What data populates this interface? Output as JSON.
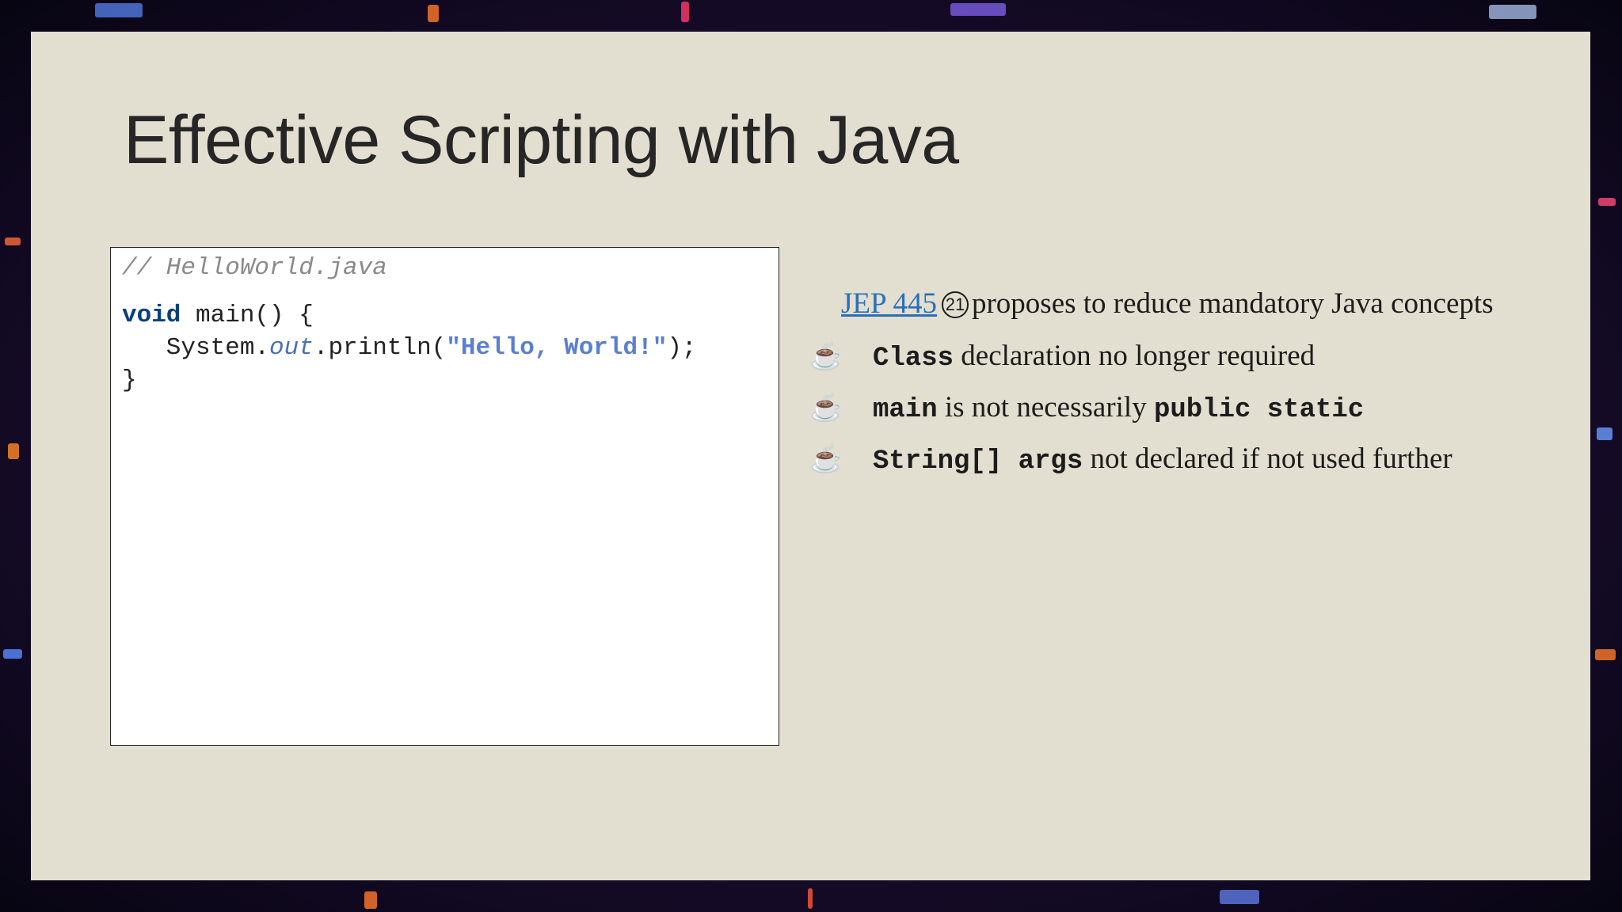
{
  "slide": {
    "title": "Effective Scripting with Java"
  },
  "code": {
    "comment": "// HelloWorld.java",
    "line1_kw": "void",
    "line1_rest": " main() {",
    "line2_prefix": "   System.",
    "line2_field": "out",
    "line2_mid": ".println(",
    "line2_string": "\"Hello, World!\"",
    "line2_end": ");",
    "line3": "}"
  },
  "notes": {
    "link_text": "JEP 445",
    "version_badge": "21",
    "intro_text": "proposes to reduce mandatory Java concepts",
    "bullet_icon": "coffee-cup-icon",
    "bullet_glyph": "☕",
    "bullets": [
      {
        "code1": "Class",
        "text1": " declaration no longer required",
        "code2": "",
        "text2": ""
      },
      {
        "code1": "main",
        "text1": " is not necessarily ",
        "code2": "public static",
        "text2": ""
      },
      {
        "code1": "String[] args",
        "text1": "  not declared if not used further",
        "code2": "",
        "text2": ""
      }
    ]
  },
  "colors": {
    "slide_bg": "#e2dfd1",
    "link": "#2a6fb8",
    "keyword": "#0b3f7a",
    "string": "#5a7fcf"
  }
}
